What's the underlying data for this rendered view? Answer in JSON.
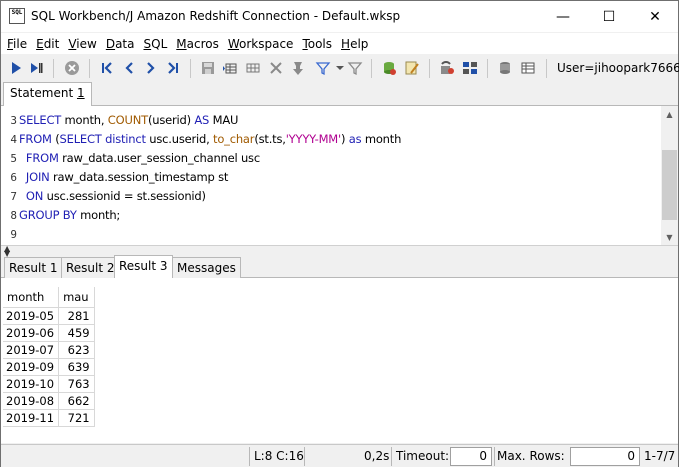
{
  "window": {
    "title": "SQL Workbench/J Amazon Redshift Connection - Default.wksp",
    "app_icon_text": "SQL",
    "minimize": "—",
    "maximize": "☐",
    "close": "✕"
  },
  "menu": [
    {
      "label": "File",
      "u": "F",
      "rest": "ile"
    },
    {
      "label": "Edit",
      "u": "E",
      "rest": "dit"
    },
    {
      "label": "View",
      "u": "V",
      "rest": "iew"
    },
    {
      "label": "Data",
      "u": "D",
      "rest": "ata"
    },
    {
      "label": "SQL",
      "u": "S",
      "rest": "QL"
    },
    {
      "label": "Macros",
      "u": "M",
      "rest": "acros"
    },
    {
      "label": "Workspace",
      "u": "W",
      "rest": "orkspace"
    },
    {
      "label": "Tools",
      "u": "T",
      "rest": "ools"
    },
    {
      "label": "Help",
      "u": "H",
      "rest": "elp"
    }
  ],
  "toolbar": {
    "user_label": "User=jihoopark7666,"
  },
  "statement_tab": {
    "label": "Statement ",
    "num": "1"
  },
  "editor": {
    "line_numbers": [
      "3",
      "4",
      "5",
      "6",
      "7",
      "8",
      "9"
    ],
    "lines": [
      [
        {
          "t": "SELECT",
          "c": "kw"
        },
        {
          "t": " month, ",
          "c": ""
        },
        {
          "t": "COUNT",
          "c": "fn"
        },
        {
          "t": "(userid) ",
          "c": ""
        },
        {
          "t": "AS",
          "c": "kw"
        },
        {
          "t": " MAU",
          "c": ""
        }
      ],
      [
        {
          "t": "FROM",
          "c": "kw"
        },
        {
          "t": " (",
          "c": ""
        },
        {
          "t": "SELECT",
          "c": "kw"
        },
        {
          "t": " ",
          "c": ""
        },
        {
          "t": "distinct",
          "c": "kw"
        },
        {
          "t": " usc.userid, ",
          "c": ""
        },
        {
          "t": "to_char",
          "c": "fn"
        },
        {
          "t": "(st.ts,",
          "c": ""
        },
        {
          "t": "'YYYY-MM'",
          "c": "str"
        },
        {
          "t": ") ",
          "c": ""
        },
        {
          "t": "as",
          "c": "kw"
        },
        {
          "t": " month",
          "c": ""
        }
      ],
      [
        {
          "t": "  ",
          "c": ""
        },
        {
          "t": "FROM",
          "c": "kw"
        },
        {
          "t": " raw_data.user_session_channel usc",
          "c": ""
        }
      ],
      [
        {
          "t": "  ",
          "c": ""
        },
        {
          "t": "JOIN",
          "c": "kw"
        },
        {
          "t": " raw_data.session_timestamp st",
          "c": ""
        }
      ],
      [
        {
          "t": "  ",
          "c": ""
        },
        {
          "t": "ON",
          "c": "kw"
        },
        {
          "t": " usc.sessionid = st.sessionid)",
          "c": ""
        }
      ],
      [
        {
          "t": "GROUP BY",
          "c": "kw"
        },
        {
          "t": " month;",
          "c": ""
        }
      ],
      []
    ]
  },
  "result_tabs": [
    {
      "label": "Result 1",
      "active": false
    },
    {
      "label": "Result 2",
      "active": false
    },
    {
      "label": "Result 3",
      "active": true
    },
    {
      "label": "Messages",
      "active": false
    }
  ],
  "results": {
    "columns": [
      "month",
      "mau"
    ],
    "rows": [
      [
        "2019-05",
        "281"
      ],
      [
        "2019-06",
        "459"
      ],
      [
        "2019-07",
        "623"
      ],
      [
        "2019-09",
        "639"
      ],
      [
        "2019-10",
        "763"
      ],
      [
        "2019-08",
        "662"
      ],
      [
        "2019-11",
        "721"
      ]
    ]
  },
  "status": {
    "cursor": "L:8 C:16",
    "time": "0,2s",
    "timeout_label": "Timeout:",
    "timeout_value": "0",
    "maxrows_label": "Max. Rows:",
    "maxrows_value": "0",
    "row_range": "1-7/7"
  }
}
